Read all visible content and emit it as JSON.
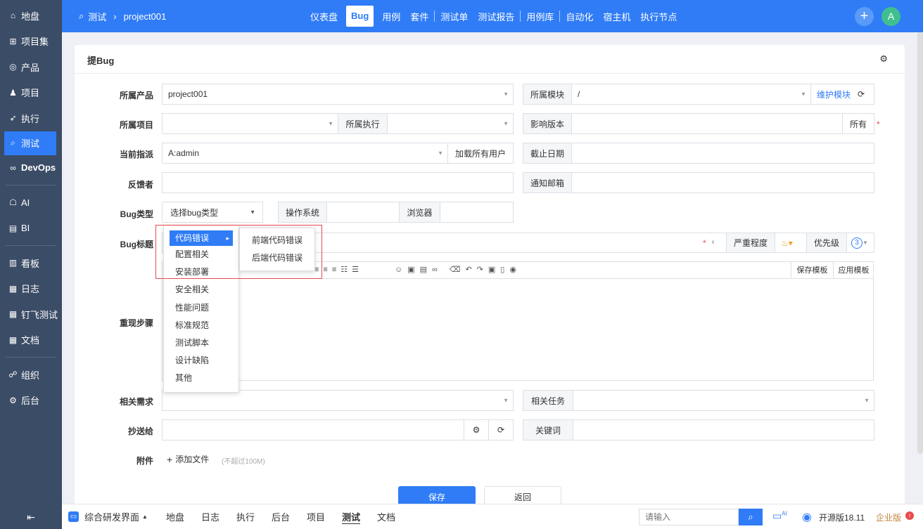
{
  "sidebar": {
    "items": [
      {
        "icon": "home-icon",
        "glyph": "⌂",
        "label": "地盘"
      },
      {
        "icon": "grid-icon",
        "glyph": "⊞",
        "label": "项目集"
      },
      {
        "icon": "location-pin-icon",
        "glyph": "◎",
        "label": "产品"
      },
      {
        "icon": "project-icon",
        "glyph": "♟",
        "label": "项目"
      },
      {
        "icon": "rocket-icon",
        "glyph": "➶",
        "label": "执行"
      },
      {
        "icon": "search-icon",
        "glyph": "⌕",
        "label": "测试"
      },
      {
        "icon": "infinity-icon",
        "glyph": "∞",
        "label": "DevOps"
      },
      {
        "icon": "robot-icon",
        "glyph": "☖",
        "label": "AI"
      },
      {
        "icon": "bi-chart-icon",
        "glyph": "▤",
        "label": "BI"
      },
      {
        "icon": "kanban-icon",
        "glyph": "▥",
        "label": "看板"
      },
      {
        "icon": "log-icon",
        "glyph": "▦",
        "label": "日志"
      },
      {
        "icon": "document-icon",
        "glyph": "▦",
        "label": "钉飞测试"
      },
      {
        "icon": "doc-icon",
        "glyph": "▦",
        "label": "文档"
      },
      {
        "icon": "people-icon",
        "glyph": "☍",
        "label": "组织"
      },
      {
        "icon": "settings-icon",
        "glyph": "⚙",
        "label": "后台"
      }
    ],
    "collapse_glyph": "⇤"
  },
  "header": {
    "breadcrumb_module": "测试",
    "breadcrumb_sep": "›",
    "breadcrumb_product": "project001",
    "nav": [
      "仪表盘",
      "Bug",
      "用例",
      "套件",
      "测试单",
      "测试报告",
      "用例库",
      "自动化",
      "宿主机",
      "执行节点"
    ],
    "active_nav": "Bug",
    "avatar": "A",
    "plus": "+"
  },
  "panel": {
    "title": "提Bug",
    "labels": {
      "product": "所属产品",
      "project": "所属项目",
      "assign": "当前指派",
      "feedback": "反馈者",
      "bugtype": "Bug类型",
      "bugtitle": "Bug标题",
      "steps": "重现步骤",
      "story": "相关需求",
      "mailto": "抄送给",
      "files": "附件"
    },
    "product_value": "project001",
    "module_label": "所属模块",
    "module_value": "/",
    "maintain_module": "维护模块",
    "execution_label": "所属执行",
    "build_label": "影响版本",
    "build_all": "所有",
    "assign_value": "A:admin",
    "load_all_users": "加载所有用户",
    "deadline_label": "截止日期",
    "notify_email_label": "通知邮箱",
    "bugtype_placeholder": "选择bug类型",
    "os_label": "操作系统",
    "browser_label": "浏览器",
    "severity_label": "严重程度",
    "priority_label": "优先级",
    "priority_value": "3",
    "save_template": "保存模板",
    "apply_template": "应用模板",
    "task_label": "相关任务",
    "keywords_label": "关键词",
    "add_file": "添加文件",
    "file_hint": "(不超过100M)",
    "save": "保存",
    "back": "返回",
    "required_mark": "*"
  },
  "dropdown": {
    "items": [
      "代码错误",
      "配置相关",
      "安装部署",
      "安全相关",
      "性能问题",
      "标准规范",
      "测试脚本",
      "设计缺陷",
      "其他"
    ],
    "active": "代码错误",
    "submenu": [
      "前端代码错误",
      "后端代码错误"
    ]
  },
  "bottombar": {
    "menu_label": "综合研发界面",
    "items": [
      "地盘",
      "日志",
      "执行",
      "后台",
      "项目",
      "测试",
      "文档"
    ],
    "active": "测试",
    "search_placeholder": "请输入",
    "ai_badge": "AI",
    "version": "开源版18.11",
    "enterprise": "企业版"
  },
  "colors": {
    "primary": "#2f7cf6",
    "sidebar": "#3b4c66",
    "required": "#e84b4b",
    "avatar": "#3fbf8f"
  }
}
